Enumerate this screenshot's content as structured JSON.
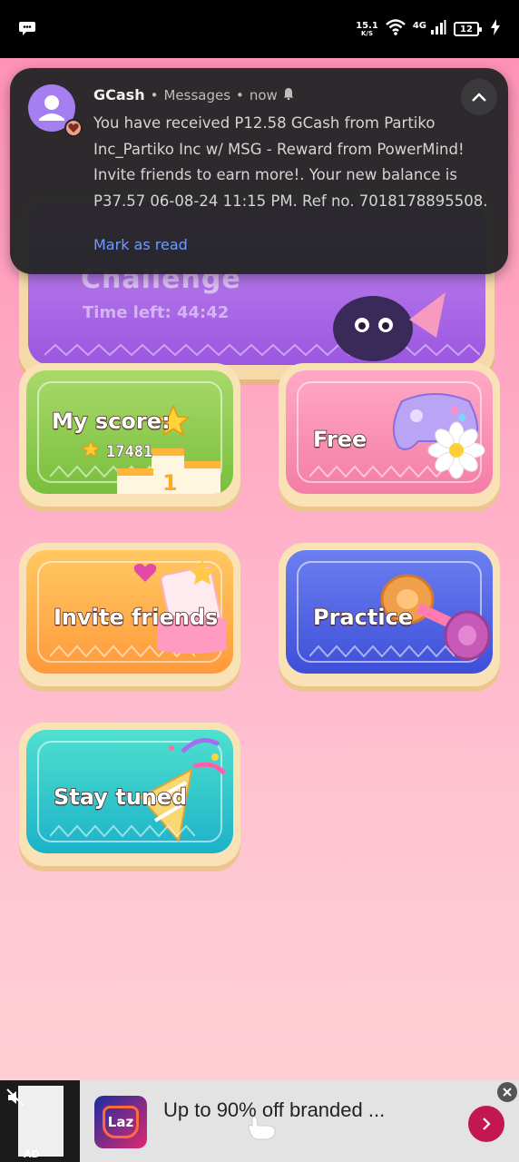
{
  "status_bar": {
    "net_speed_value": "15.1",
    "net_speed_unit": "K/S",
    "network_type": "4G",
    "battery_level": "12",
    "icons": [
      "chat-bubble-icon",
      "wifi-icon",
      "signal-icon",
      "battery-icon",
      "charging-icon"
    ]
  },
  "background_app": {
    "challenge_title": "Challenge",
    "challenge_subtitle": "Time left: 44:42",
    "tiles": {
      "my_score": {
        "label": "My score:",
        "value": "17481"
      },
      "free": {
        "label": "Free"
      },
      "invite": {
        "label": "Invite friends"
      },
      "practice": {
        "label": "Practice"
      },
      "stay_tuned": {
        "label": "Stay tuned"
      }
    }
  },
  "notification": {
    "app_name": "GCash",
    "channel": "Messages",
    "time": "now",
    "body": "You have received P12.58 GCash from Partiko Inc_Partiko Inc w/ MSG - Reward from PowerMind! Invite friends to earn more!. Your new balance is P37.57 06-08-24 11:15 PM. Ref no. 7018178895508.",
    "action_label": "Mark as read",
    "separator": "•"
  },
  "ad": {
    "label": "AD",
    "brand": "Laz",
    "headline": "Up to 90% off branded ...",
    "colors": {
      "cta": "#c2184f",
      "logo_from": "#1a2ea0",
      "logo_to": "#e0296f"
    }
  }
}
